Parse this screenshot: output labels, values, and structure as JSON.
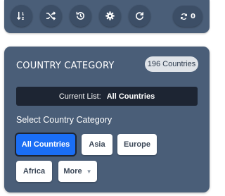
{
  "toolbar": {
    "buttons": [
      {
        "icon": "sort-icon"
      },
      {
        "icon": "shuffle-icon"
      },
      {
        "icon": "history-icon"
      },
      {
        "icon": "settings-icon"
      },
      {
        "icon": "redo-icon"
      }
    ],
    "counter": {
      "icon": "sync-icon",
      "value": "0"
    }
  },
  "category": {
    "title": "COUNTRY CATEGORY",
    "count_badge": "196 Countries",
    "current_list_label": "Current List:",
    "current_list_value": "All Countries",
    "select_label": "Select Country Category",
    "chips": [
      {
        "label": "All Countries",
        "active": true
      },
      {
        "label": "Asia",
        "active": false
      },
      {
        "label": "Europe",
        "active": false
      },
      {
        "label": "Africa",
        "active": false
      },
      {
        "label": "More",
        "active": false
      }
    ]
  },
  "colors": {
    "panel": "#4a5e78",
    "button": "#3c4e66",
    "active_chip": "#1a6ef5",
    "current_bar": "#1d2533"
  }
}
